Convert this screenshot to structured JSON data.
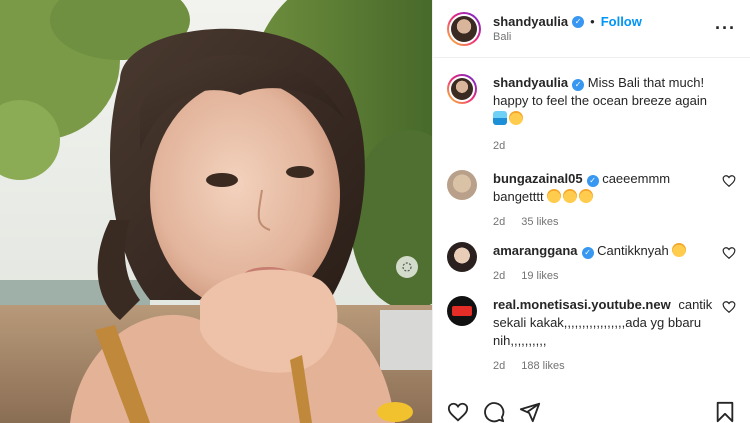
{
  "header": {
    "username": "shandyaulia",
    "separator": "•",
    "follow_label": "Follow",
    "location": "Bali",
    "more_icon": "more-horizontal-icon"
  },
  "caption": {
    "username": "shandyaulia",
    "text": "Miss Bali that much! happy to feel the ocean breeze again",
    "time": "2d"
  },
  "comments": [
    {
      "username": "bungazainal05",
      "text": "caeeemmm bangetttt",
      "emojis": 3,
      "time": "2d",
      "likes": "35 likes"
    },
    {
      "username": "amaranggana",
      "text": "Cantikknyah",
      "emojis": 1,
      "time": "2d",
      "likes": "19 likes"
    },
    {
      "username": "real.monetisasi.youtube.new",
      "text": "cantik sekali kakak,,,,,,,,,,,,,,,,,ada yg bbaru nih,,,,,,,,,,",
      "emojis": 0,
      "time": "2d",
      "likes": "188 likes"
    }
  ],
  "actions": [
    "heart-icon",
    "comment-icon",
    "share-icon",
    "bookmark-icon"
  ],
  "colors": {
    "follow": "#0095f6",
    "verified": "#3897f0",
    "muted": "#737373"
  }
}
